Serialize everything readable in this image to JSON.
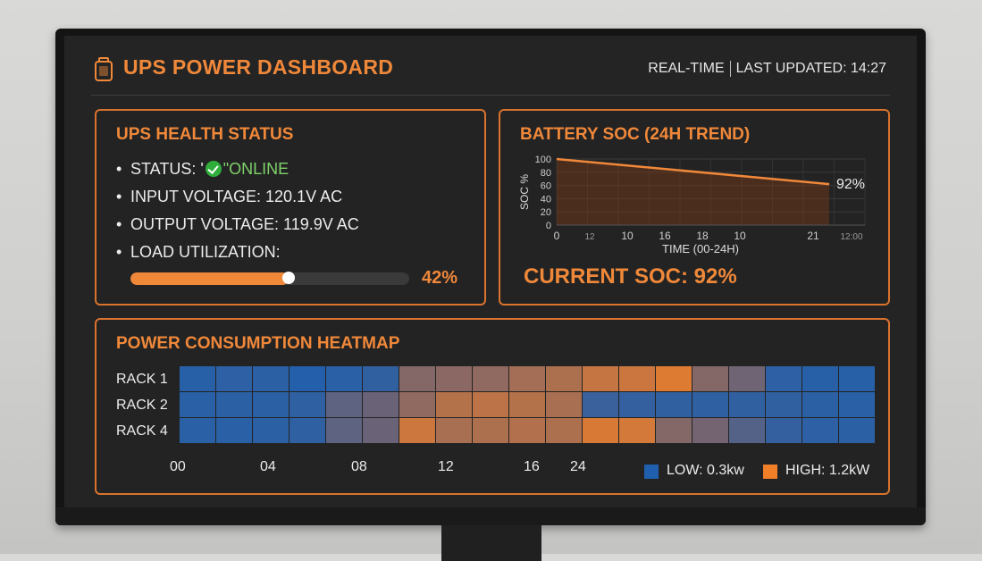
{
  "header": {
    "title": "UPS POWER DASHBOARD",
    "mode": "REAL-TIME",
    "last_updated": "LAST UPDATED: 14:27"
  },
  "colors": {
    "accent": "#f0883a",
    "panel_border": "#d9732e",
    "ok": "#2fae3c"
  },
  "health": {
    "title": "UPS HEALTH STATUS",
    "status_label": "STATUS: '",
    "status_value": "\"ONLINE",
    "input_voltage": "INPUT VOLTAGE: 120.1V AC",
    "output_voltage": "OUTPUT VOLTAGE: 119.9V AC",
    "load_label": "LOAD UTILIZATION:",
    "load_percent_text": "42%",
    "load_value": 0.42
  },
  "soc": {
    "title": "BATTERY SOC (24H TREND)",
    "current": "CURRENT SOC: 92%",
    "chart_data": {
      "type": "area",
      "title": "",
      "ylabel": "SOC %",
      "xlabel": "TIME (00-24H)",
      "ylim": [
        0,
        100
      ],
      "yticks": [
        "100",
        "80",
        "60",
        "40",
        "20",
        "0"
      ],
      "xticks": [
        "0",
        "12",
        "10",
        "16",
        "18",
        "10",
        "21",
        "12:00"
      ],
      "series": [
        {
          "x": [
            0,
            24
          ],
          "y": [
            100,
            62
          ]
        }
      ],
      "end_label": "92%"
    }
  },
  "heatmap": {
    "title": "POWER CONSUMPTION HEATMAP",
    "rows": [
      "RACK 1",
      "RACK 2",
      "RACK 4"
    ],
    "x_labels": [
      "00",
      "04",
      "08",
      "12",
      "16",
      "24"
    ],
    "legend_low": "LOW: 0.3kw",
    "legend_high": "HIGH: 1.2kW",
    "legend_low_color": "#1f5fae",
    "legend_high_color": "#f07f28",
    "values": [
      [
        0.05,
        0.08,
        0.07,
        0.02,
        0.06,
        0.1,
        0.55,
        0.58,
        0.6,
        0.68,
        0.72,
        0.82,
        0.84,
        0.92,
        0.55,
        0.45,
        0.08,
        0.05,
        0.05
      ],
      [
        0.06,
        0.07,
        0.07,
        0.09,
        0.35,
        0.42,
        0.6,
        0.75,
        0.78,
        0.75,
        0.7,
        0.15,
        0.12,
        0.1,
        0.09,
        0.1,
        0.1,
        0.07,
        0.06
      ],
      [
        0.06,
        0.06,
        0.07,
        0.09,
        0.35,
        0.42,
        0.85,
        0.7,
        0.72,
        0.74,
        0.72,
        0.9,
        0.88,
        0.55,
        0.48,
        0.3,
        0.12,
        0.08,
        0.07
      ]
    ]
  }
}
